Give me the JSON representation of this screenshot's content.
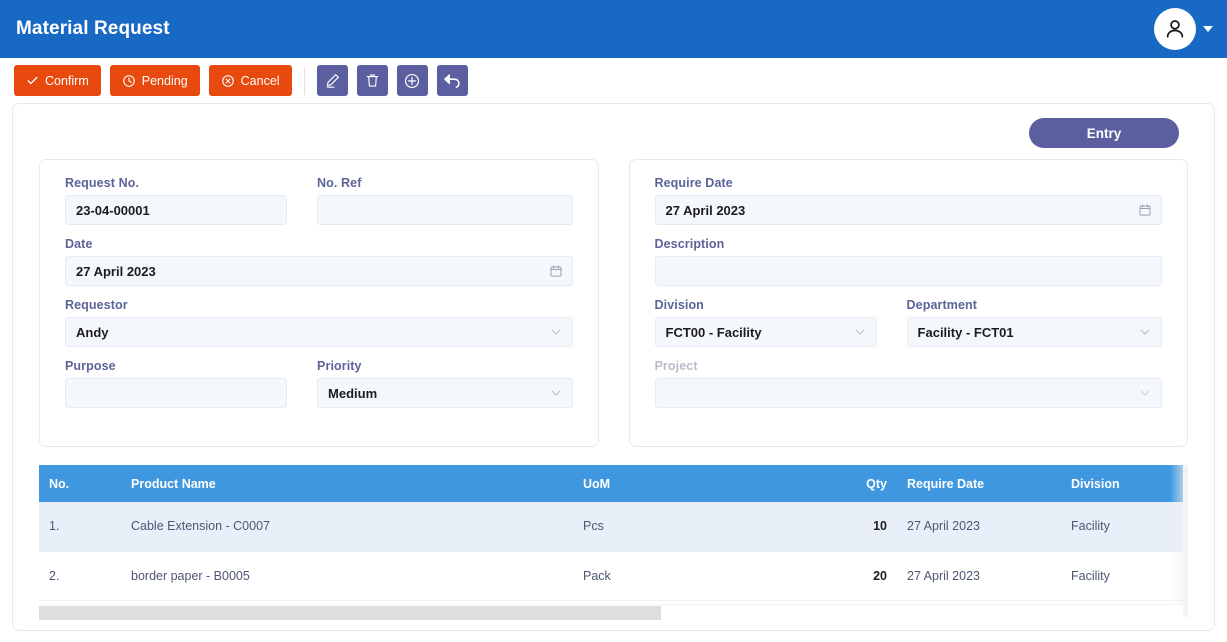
{
  "header": {
    "title": "Material Request",
    "avatar_icon": "user-icon",
    "caret_icon": "chevron-down-icon"
  },
  "toolbar": {
    "buttons": [
      {
        "label": "Confirm",
        "icon": "check-icon",
        "color": "#e8490f"
      },
      {
        "label": "Pending",
        "icon": "clock-icon",
        "color": "#e8490f"
      },
      {
        "label": "Cancel",
        "icon": "circle-x-icon",
        "color": "#e8490f"
      }
    ],
    "icon_buttons": [
      {
        "name": "edit-icon",
        "color": "#5b5fa0"
      },
      {
        "name": "trash-icon",
        "color": "#5b5fa0"
      },
      {
        "name": "plus-circle-icon",
        "color": "#5b5fa0"
      },
      {
        "name": "back-arrow-icon",
        "color": "#5b5fa0"
      }
    ]
  },
  "entry": {
    "label": "Entry",
    "color": "#5b5fa0"
  },
  "form": {
    "left": {
      "request_no": {
        "label": "Request No.",
        "value": "23-04-00001",
        "placeholder": ""
      },
      "no_ref": {
        "label": "No. Ref",
        "value": "",
        "placeholder": ""
      },
      "date": {
        "label": "Date",
        "value": "27 April 2023",
        "icon": "calendar-icon"
      },
      "requestor": {
        "label": "Requestor",
        "value": "Andy",
        "icon": "chevron-down-icon"
      },
      "purpose": {
        "label": "Purpose",
        "value": "",
        "placeholder": ""
      },
      "priority": {
        "label": "Priority",
        "value": "Medium",
        "icon": "chevron-down-icon"
      }
    },
    "right": {
      "require_date": {
        "label": "Require Date",
        "value": "27 April 2023",
        "icon": "calendar-icon"
      },
      "description": {
        "label": "Description",
        "value": "",
        "placeholder": ""
      },
      "division": {
        "label": "Division",
        "value": "FCT00 - Facility",
        "icon": "chevron-down-icon"
      },
      "department": {
        "label": "Department",
        "value": "Facility - FCT01",
        "icon": "chevron-down-icon"
      },
      "project": {
        "label": "Project",
        "value": "",
        "icon": "chevron-down-icon",
        "disabled": true
      }
    }
  },
  "table": {
    "header_color": "#3f97e0",
    "columns": [
      "No.",
      "Product Name",
      "UoM",
      "Qty",
      "Require Date",
      "Division"
    ],
    "rows": [
      {
        "no": "1.",
        "product": "Cable Extension - C0007",
        "uom": "Pcs",
        "qty": "10",
        "require_date": "27 April 2023",
        "division": "Facility"
      },
      {
        "no": "2.",
        "product": "border paper - B0005",
        "uom": "Pack",
        "qty": "20",
        "require_date": "27 April 2023",
        "division": "Facility"
      }
    ]
  },
  "scrollbar": {
    "name": "horizontal-scrollbar"
  }
}
